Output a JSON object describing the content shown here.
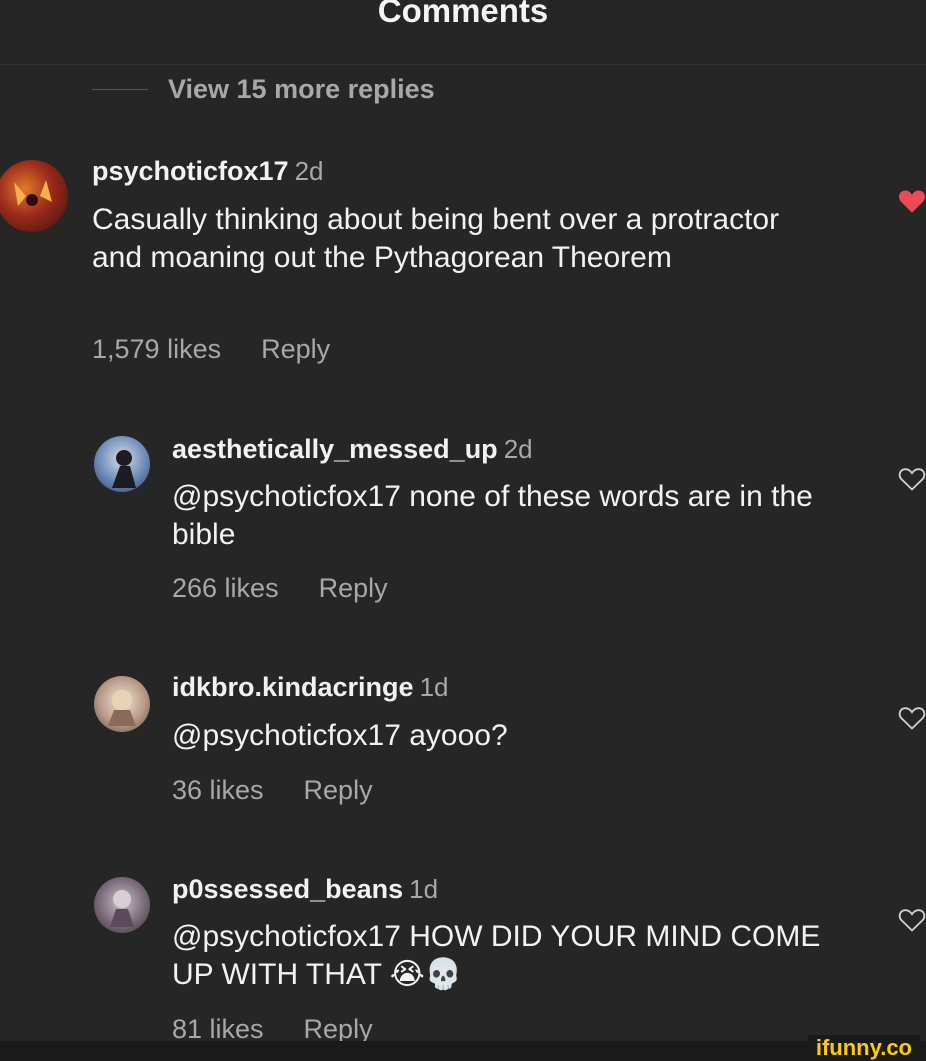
{
  "header": {
    "title": "Comments"
  },
  "view_more": "View 15 more replies",
  "comments": [
    {
      "username": "psychoticfox17",
      "time": "2d",
      "text": "Casually thinking about being bent over a protractor and moaning out the Pythagorean Theorem",
      "likes": "1,579 likes",
      "reply": "Reply",
      "liked": true
    },
    {
      "username": "aesthetically_messed_up",
      "time": "2d",
      "text": "@psychoticfox17 none of these words are in the bible",
      "likes": "266 likes",
      "reply": "Reply",
      "liked": false
    },
    {
      "username": "idkbro.kindacringe",
      "time": "1d",
      "text": "@psychoticfox17 ayooo?",
      "likes": "36 likes",
      "reply": "Reply",
      "liked": false
    },
    {
      "username": "p0ssessed_beans",
      "time": "1d",
      "text": "@psychoticfox17 HOW DID YOUR MIND COME UP WITH THAT 😭💀",
      "likes": "81 likes",
      "reply": "Reply",
      "liked": false
    }
  ],
  "watermark": "ifunny.co",
  "colors": {
    "liked_heart": "#ed4956",
    "muted": "#a8a8a8",
    "background": "#262626"
  }
}
